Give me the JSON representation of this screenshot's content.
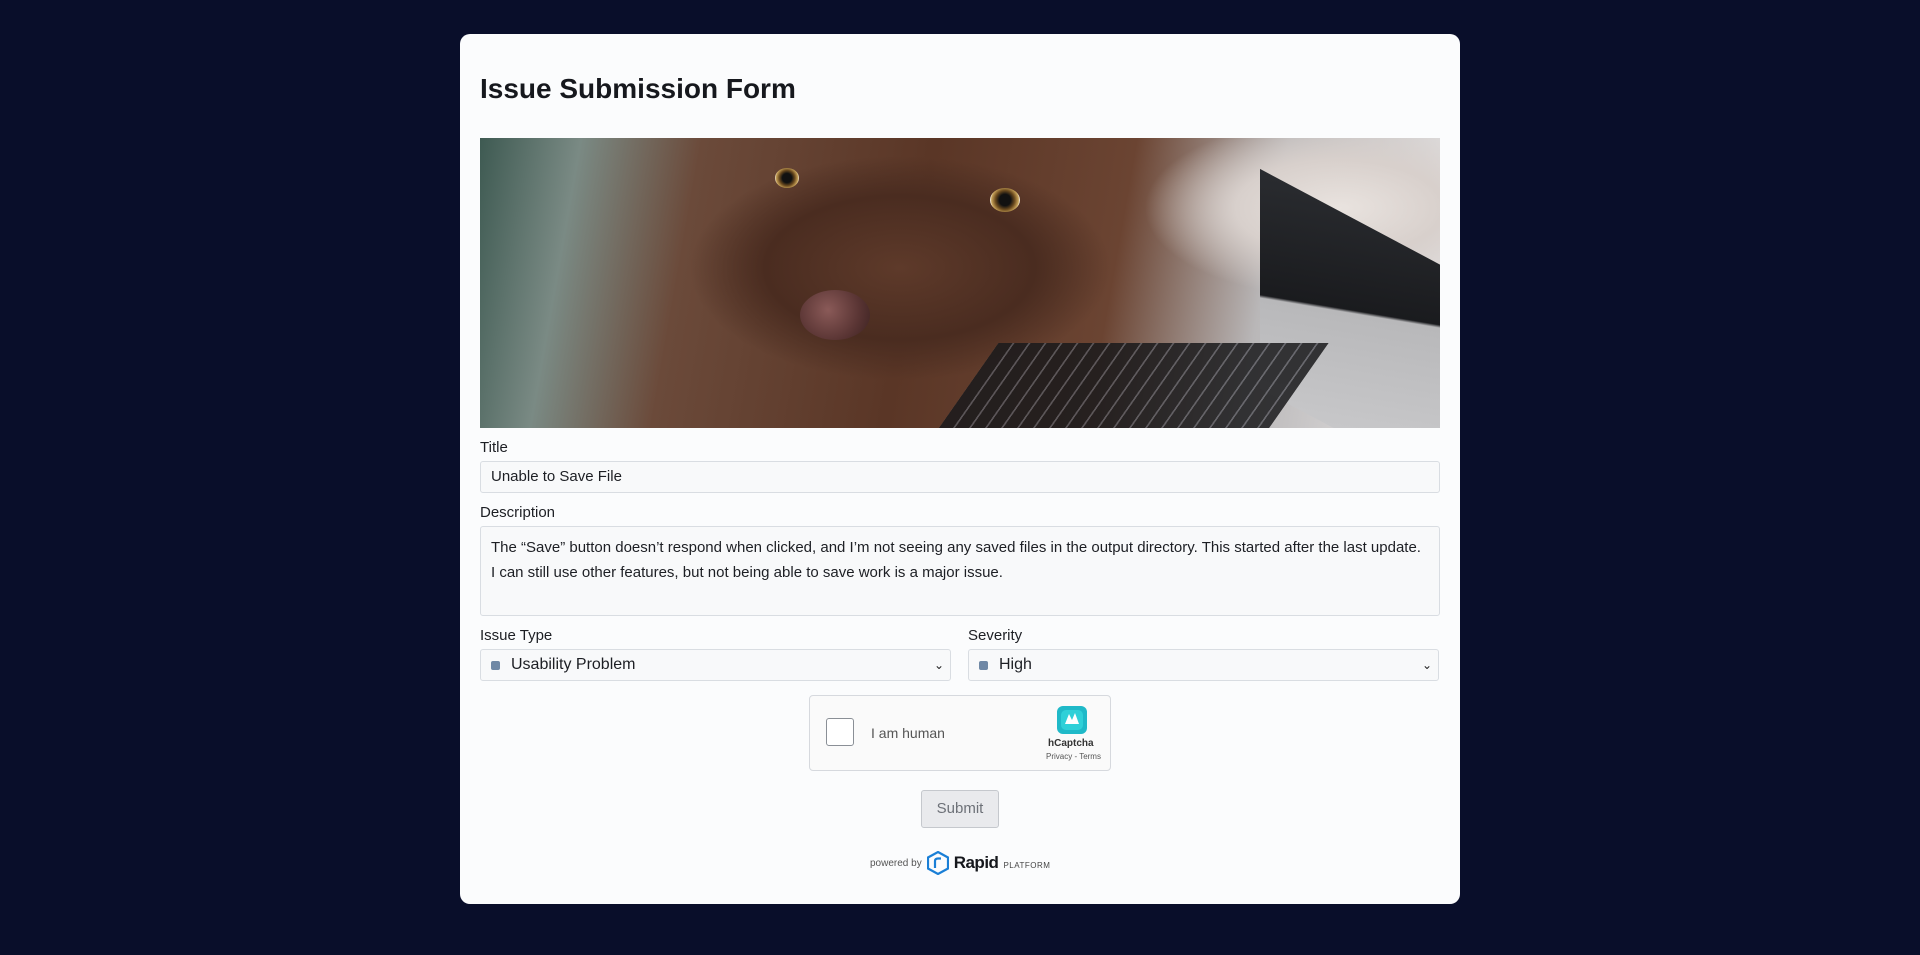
{
  "form": {
    "title": "Issue Submission Form",
    "hero_image": "dog-on-laptop-photo"
  },
  "fields": {
    "title": {
      "label": "Title",
      "value": "Unable to Save File"
    },
    "description": {
      "label": "Description",
      "value": "The “Save” button doesn’t respond when clicked, and I’m not seeing any saved files in the output directory. This started after the last update. I can still use other features, but not being able to save work is a major issue."
    },
    "issue_type": {
      "label": "Issue Type",
      "value": "Usability Problem"
    },
    "severity": {
      "label": "Severity",
      "value": "High"
    }
  },
  "captcha": {
    "label": "I am human",
    "brand": "hCaptcha",
    "links": "Privacy - Terms"
  },
  "actions": {
    "submit_label": "Submit"
  },
  "footer": {
    "powered_by": "powered by",
    "brand": "Rapid",
    "brand_suffix": "PLATFORM"
  },
  "colors": {
    "page_background": "#090e2a",
    "card_background": "#fbfcfd",
    "select_dot": "#6f88a5"
  }
}
